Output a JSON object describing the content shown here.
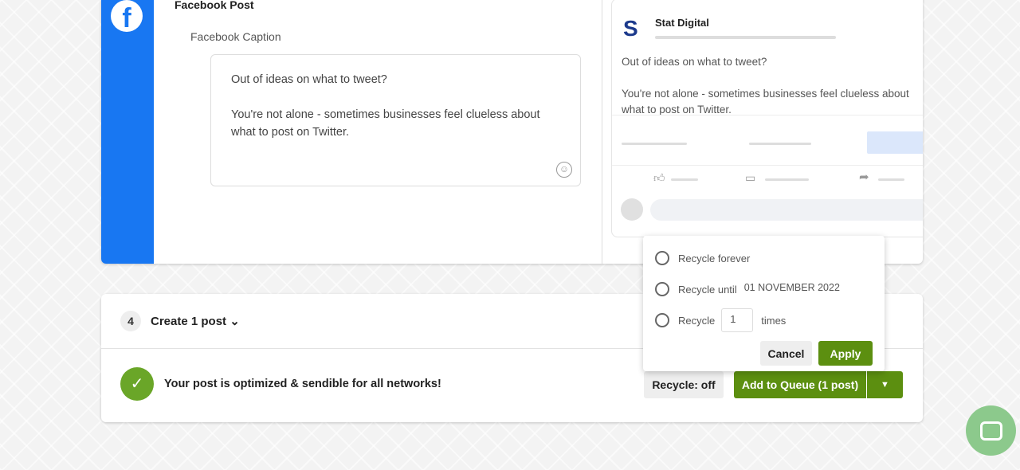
{
  "post": {
    "title": "Facebook Post",
    "caption_label": "Facebook Caption",
    "caption_lines": [
      "Out of ideas on what to tweet?",
      "You're not alone - sometimes businesses feel clueless about what to post on Twitter."
    ]
  },
  "preview": {
    "page_name": "Stat Digital",
    "lines": [
      "Out of ideas on what to tweet?",
      "You're not alone - sometimes businesses feel clueless about what to post on Twitter."
    ]
  },
  "footer": {
    "step_number": "4",
    "create_label": "Create 1 post",
    "status": "Your post is optimized & sendible for all networks!",
    "recycle_label": "Recycle: off",
    "queue_label": "Add to Queue (1 post)"
  },
  "recycle_popover": {
    "forever": "Recycle forever",
    "until": "Recycle until",
    "until_date": "01 NOVEMBER 2022",
    "recycle": "Recycle",
    "times_value": "1",
    "times": "times",
    "cancel": "Cancel",
    "apply": "Apply"
  },
  "colors": {
    "facebook": "#1877f2",
    "primary": "#5c8f10",
    "success": "#6aa628"
  }
}
